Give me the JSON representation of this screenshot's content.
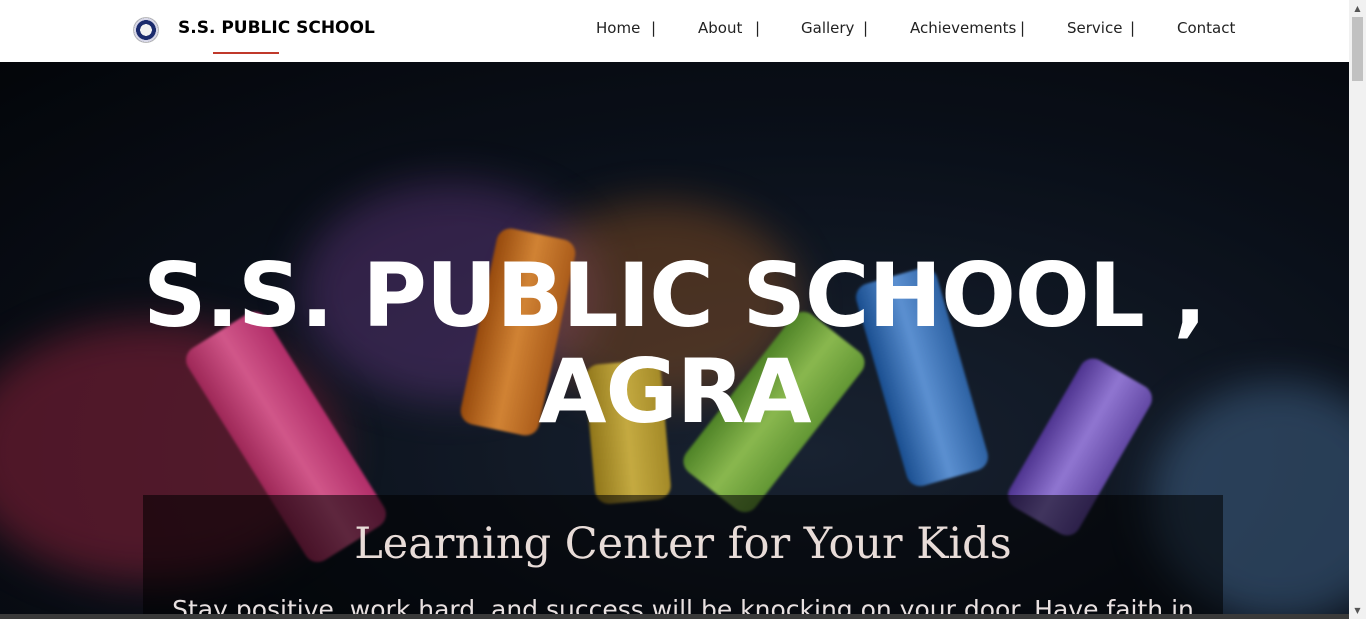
{
  "brand": {
    "name": "S.S. PUBLIC SCHOOL",
    "logo_icon": "school-crest-icon"
  },
  "nav": {
    "items": [
      {
        "label": "Home"
      },
      {
        "label": "About"
      },
      {
        "label": "Gallery"
      },
      {
        "label": "Achievements"
      },
      {
        "label": "Service"
      },
      {
        "label": "Contact"
      }
    ],
    "separator": "|"
  },
  "hero": {
    "title": "S.S. PUBLIC SCHOOL , AGRA",
    "subtitle": "Learning Center for Your Kids",
    "text": "Stay positive, work hard, and success will be knocking on your door. Have faith in"
  },
  "colors": {
    "brand_underline": "#c0392b",
    "hero_title": "#ffffff",
    "caption_title": "#e8dcd8"
  }
}
